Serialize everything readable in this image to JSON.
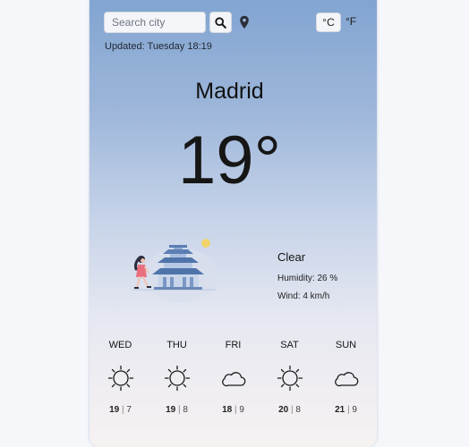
{
  "search": {
    "placeholder": "Search city"
  },
  "units": {
    "celsius": "°C",
    "fahrenheit": "°F",
    "active": "celsius"
  },
  "updated": "Updated: Tuesday 18:19",
  "city": "Madrid",
  "current": {
    "temperature": "19°",
    "description": "Clear",
    "humidity": "Humidity: 26 %",
    "wind": "Wind: 4 km/h",
    "illustration": "woman-walking-by-pagoda-illustration"
  },
  "forecast": [
    {
      "day": "WED",
      "icon": "sun-icon",
      "high": "19",
      "low": "7"
    },
    {
      "day": "THU",
      "icon": "sun-icon",
      "high": "19",
      "low": "8"
    },
    {
      "day": "FRI",
      "icon": "cloud-icon",
      "high": "18",
      "low": "9"
    },
    {
      "day": "SAT",
      "icon": "sun-icon",
      "high": "20",
      "low": "8"
    },
    {
      "day": "SUN",
      "icon": "cloud-icon",
      "high": "21",
      "low": "9"
    }
  ],
  "colors": {
    "card_top": "#7fa3d0",
    "card_bottom": "#f7f2f2",
    "sun_yellow": "#f1d36a",
    "figure_pink": "#e8707e"
  }
}
